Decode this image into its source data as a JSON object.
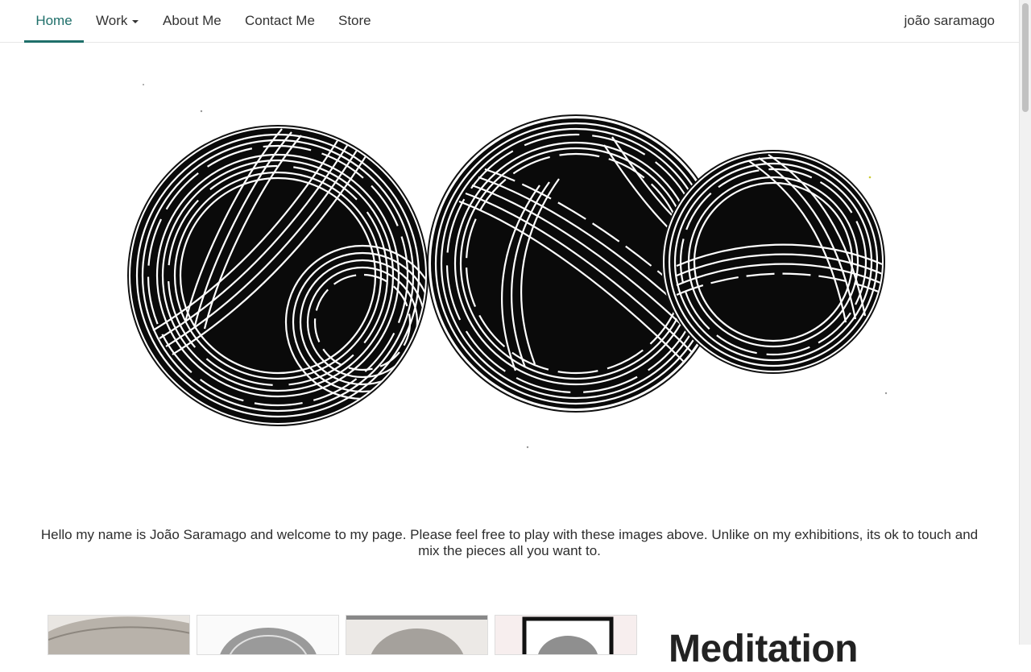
{
  "nav": {
    "items": [
      {
        "label": "Home"
      },
      {
        "label": "Work"
      },
      {
        "label": "About Me"
      },
      {
        "label": "Contact Me"
      },
      {
        "label": "Store"
      }
    ],
    "brand": "joão saramago"
  },
  "intro": {
    "text": "Hello my name is João Saramago and welcome to my page. Please feel free to play with these images above. Unlike on my exhibitions, its ok to touch and mix the pieces all you want to."
  },
  "gallery": {
    "title": "Meditation"
  },
  "colors": {
    "accent": "#1f6f6a",
    "text": "#333333",
    "nav_border": "#e6e6e6"
  }
}
